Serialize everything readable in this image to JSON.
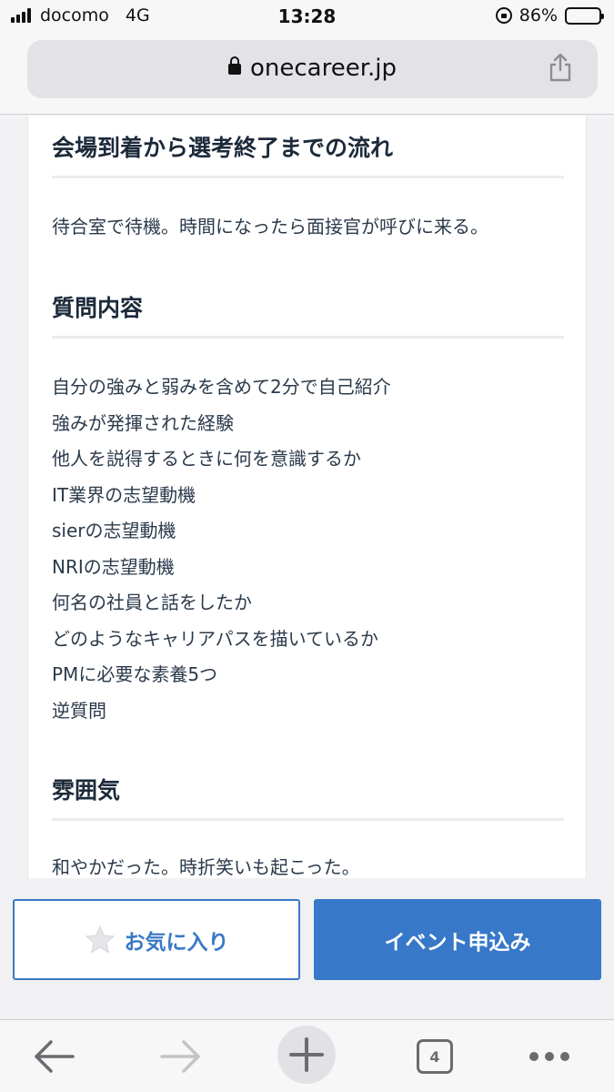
{
  "status_bar": {
    "carrier": "docomo",
    "network": "4G",
    "time": "13:28",
    "battery": "86%",
    "battery_level": 0.86
  },
  "browser": {
    "url": "onecareer.jp",
    "tab_count": "4"
  },
  "sections": [
    {
      "title": "会場到着から選考終了までの流れ",
      "text": "待合室で待機。時間になったら面接官が呼びに来る。"
    },
    {
      "title": "質問内容",
      "items": [
        "自分の強みと弱みを含めて2分で自己紹介",
        "強みが発揮された経験",
        "他人を説得するときに何を意識するか",
        "IT業界の志望動機",
        "sierの志望動機",
        "NRIの志望動機",
        "何名の社員と話をしたか",
        "どのようなキャリアパスを描いているか",
        "PMに必要な素養5つ",
        "逆質問"
      ]
    },
    {
      "title": "雰囲気",
      "text": "和やかだった。時折笑いも起こった。"
    }
  ],
  "actions": {
    "favorite_label": "お気に入り",
    "apply_label": "イベント申込み"
  },
  "colors": {
    "accent": "#3778c8",
    "heading": "#1c2a3a",
    "body_text": "#2b3a4b"
  },
  "icons": [
    "signal-icon",
    "rotation-lock-icon",
    "battery-icon",
    "padlock-icon",
    "share-icon",
    "star-icon",
    "back-arrow-icon",
    "forward-arrow-icon",
    "plus-icon",
    "tabs-icon",
    "more-icon"
  ]
}
